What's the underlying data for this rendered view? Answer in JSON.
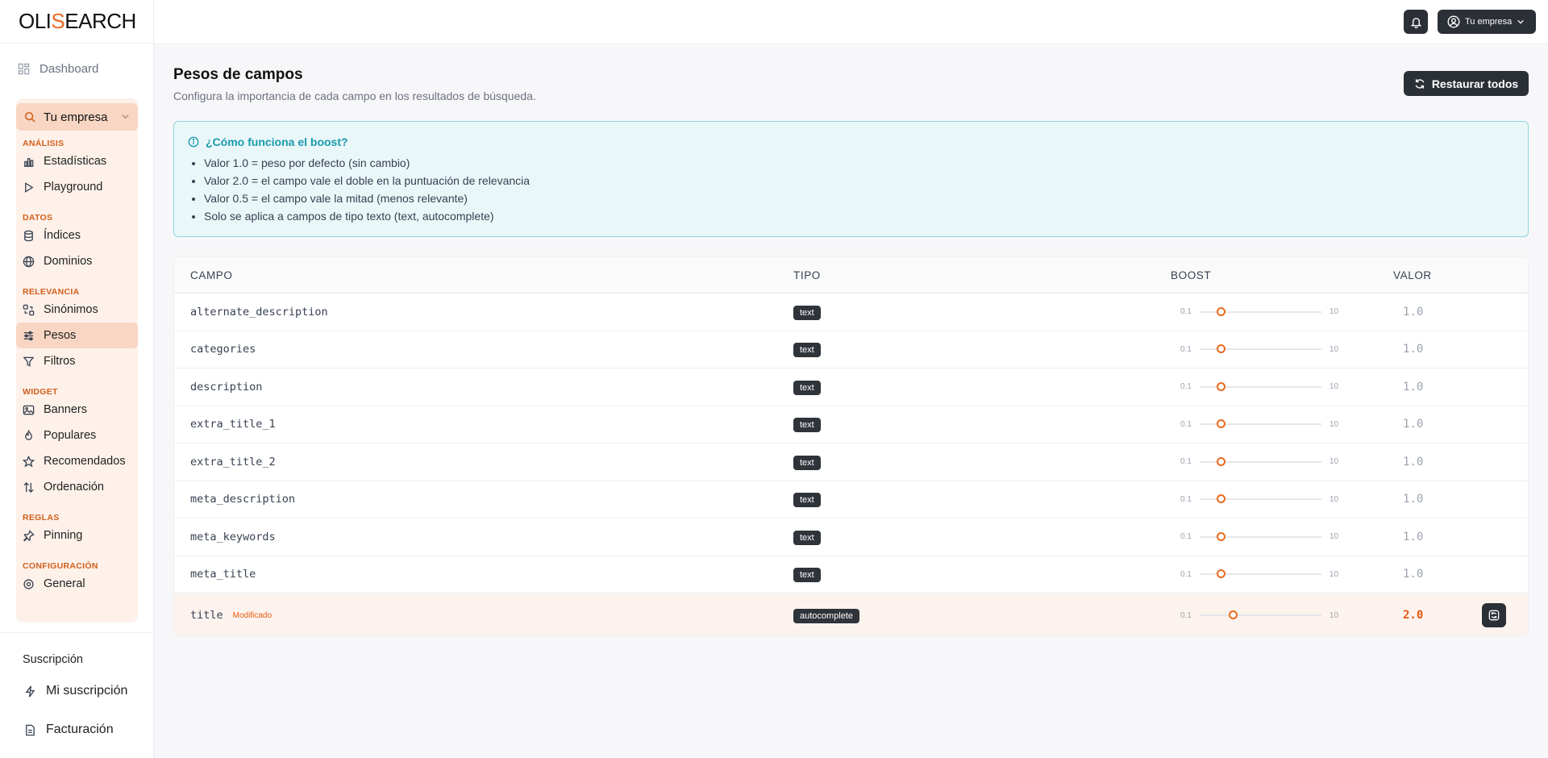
{
  "brand": {
    "logo_left": "OLI",
    "logo_accent": "S",
    "logo_right": "EARCH",
    "accent_color": "#ea6a1f"
  },
  "sidebar": {
    "dashboard": "Dashboard",
    "company": "Tu empresa",
    "sections": [
      {
        "title": "ANÁLISIS",
        "items": [
          {
            "label": "Estadísticas",
            "icon": "bar-chart-icon"
          },
          {
            "label": "Playground",
            "icon": "play-icon"
          }
        ]
      },
      {
        "title": "DATOS",
        "items": [
          {
            "label": "Índices",
            "icon": "database-icon"
          },
          {
            "label": "Dominios",
            "icon": "globe-icon"
          }
        ]
      },
      {
        "title": "RELEVANCIA",
        "items": [
          {
            "label": "Sinónimos",
            "icon": "synonyms-icon"
          },
          {
            "label": "Pesos",
            "icon": "sliders-icon",
            "active": true
          },
          {
            "label": "Filtros",
            "icon": "filter-icon"
          }
        ]
      },
      {
        "title": "WIDGET",
        "items": [
          {
            "label": "Banners",
            "icon": "image-icon"
          },
          {
            "label": "Populares",
            "icon": "flame-icon"
          },
          {
            "label": "Recomendados",
            "icon": "star-icon"
          },
          {
            "label": "Ordenación",
            "icon": "sort-icon"
          }
        ]
      },
      {
        "title": "REGLAS",
        "items": [
          {
            "label": "Pinning",
            "icon": "pin-icon"
          }
        ]
      },
      {
        "title": "CONFIGURACIÓN",
        "items": [
          {
            "label": "General",
            "icon": "gear-icon"
          }
        ]
      }
    ],
    "footer": {
      "title": "Suscripción",
      "subscription": "Mi suscripción",
      "billing": "Facturación"
    }
  },
  "topbar": {
    "user_label": "Tu empresa"
  },
  "page": {
    "title": "Pesos de campos",
    "subtitle": "Configura la importancia de cada campo en los resultados de búsqueda.",
    "restore_all": "Restaurar todos"
  },
  "info": {
    "title": "¿Cómo funciona el boost?",
    "bullets": [
      "Valor 1.0 = peso por defecto (sin cambio)",
      "Valor 2.0 = el campo vale el doble en la puntuación de relevancia",
      "Valor 0.5 = el campo vale la mitad (menos relevante)",
      "Solo se aplica a campos de tipo texto (text, autocomplete)"
    ]
  },
  "table": {
    "headers": {
      "campo": "CAMPO",
      "tipo": "TIPO",
      "boost": "BOOST",
      "valor": "VALOR"
    },
    "slider_min": "0.1",
    "slider_max": "10",
    "modified_label": "Modificado",
    "rows": [
      {
        "field": "alternate_description",
        "type": "text",
        "value": "1.0",
        "boost": 1.0,
        "modified": false
      },
      {
        "field": "categories",
        "type": "text",
        "value": "1.0",
        "boost": 1.0,
        "modified": false
      },
      {
        "field": "description",
        "type": "text",
        "value": "1.0",
        "boost": 1.0,
        "modified": false
      },
      {
        "field": "extra_title_1",
        "type": "text",
        "value": "1.0",
        "boost": 1.0,
        "modified": false
      },
      {
        "field": "extra_title_2",
        "type": "text",
        "value": "1.0",
        "boost": 1.0,
        "modified": false
      },
      {
        "field": "meta_description",
        "type": "text",
        "value": "1.0",
        "boost": 1.0,
        "modified": false
      },
      {
        "field": "meta_keywords",
        "type": "text",
        "value": "1.0",
        "boost": 1.0,
        "modified": false
      },
      {
        "field": "meta_title",
        "type": "text",
        "value": "1.0",
        "boost": 1.0,
        "modified": false
      },
      {
        "field": "title",
        "type": "autocomplete",
        "value": "2.0",
        "boost": 2.0,
        "modified": true
      }
    ]
  }
}
